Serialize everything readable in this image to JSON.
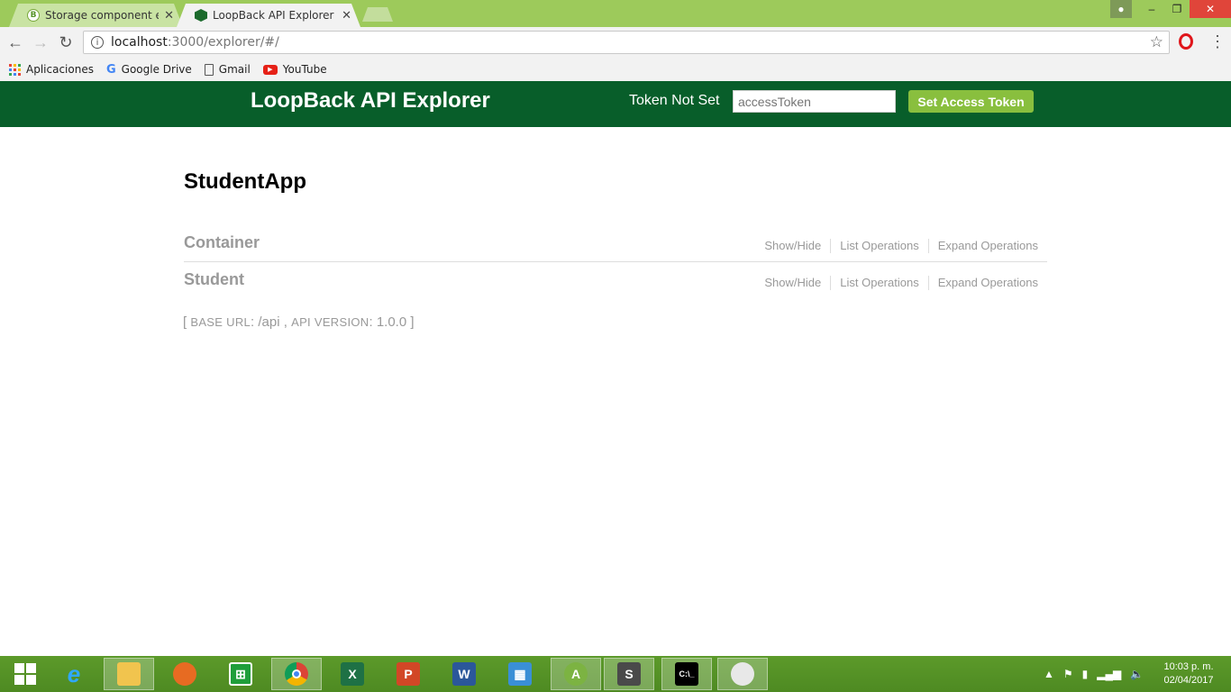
{
  "browser": {
    "tabs": [
      {
        "title": "Storage component exar",
        "active": false
      },
      {
        "title": "LoopBack API Explorer",
        "active": true
      }
    ],
    "address": {
      "host": "localhost",
      "path": ":3000/explorer/#/"
    },
    "bookmarks": [
      "Aplicaciones",
      "Google Drive",
      "Gmail",
      "YouTube"
    ]
  },
  "header": {
    "title": "LoopBack API Explorer",
    "token_status": "Token Not Set",
    "token_placeholder": "accessToken",
    "token_button": "Set Access Token",
    "color": "#085e2a",
    "button_color": "#89bf3e"
  },
  "content": {
    "app_name": "StudentApp",
    "resources": [
      {
        "name": "Container",
        "ops": [
          "Show/Hide",
          "List Operations",
          "Expand Operations"
        ]
      },
      {
        "name": "Student",
        "ops": [
          "Show/Hide",
          "List Operations",
          "Expand Operations"
        ]
      }
    ],
    "base_url_label": "BASE URL",
    "base_url": "/api",
    "api_version_label": "API VERSION",
    "api_version": "1.0.0"
  },
  "taskbar": {
    "apps": [
      "start",
      "internet-explorer",
      "file-explorer",
      "firefox",
      "store",
      "chrome",
      "excel",
      "powerpoint",
      "word",
      "control-panel",
      "android-studio",
      "sublime-text",
      "cmd",
      "paint"
    ],
    "time": "10:03 p. m.",
    "date": "02/04/2017"
  }
}
